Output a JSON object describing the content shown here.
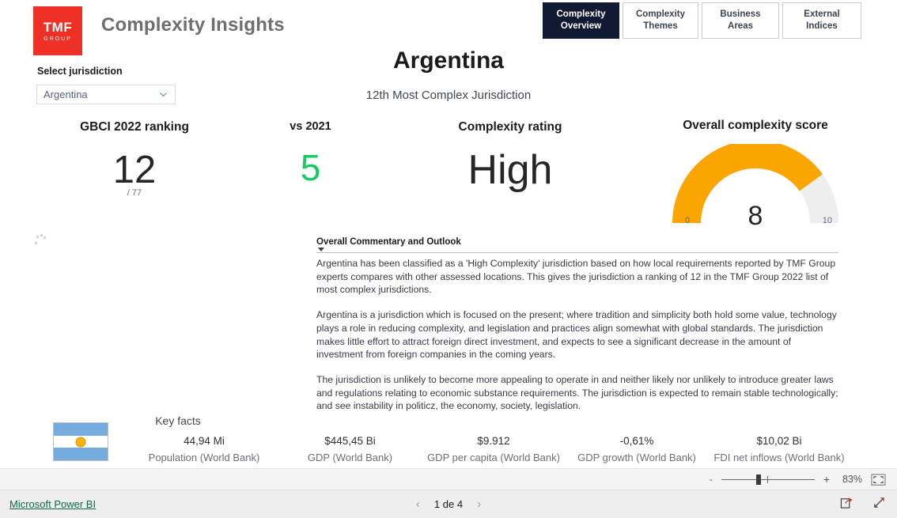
{
  "header": {
    "logo": {
      "primary": "TMF",
      "secondary": "GROUP",
      "color": "#ee3124"
    },
    "title": "Complexity Insights"
  },
  "tabs": [
    {
      "label": "Complexity Overview",
      "active": true
    },
    {
      "label": "Complexity Themes",
      "active": false
    },
    {
      "label": "Business Areas",
      "active": false
    },
    {
      "label": "External Indices",
      "active": false
    }
  ],
  "selector": {
    "label": "Select jurisdiction",
    "value": "Argentina",
    "placeholder": "Select jurisdiction"
  },
  "jurisdiction": {
    "name": "Argentina",
    "subtitle": "12th Most Complex Jurisdiction"
  },
  "kpis": {
    "ranking": {
      "caption": "GBCI 2022 ranking",
      "value": "12",
      "sub": "/ 77"
    },
    "vs_previous": {
      "caption": "vs 2021",
      "value": "5",
      "color": "#18c964"
    },
    "rating": {
      "caption": "Complexity rating",
      "value": "High"
    },
    "score": {
      "caption": "Overall complexity score",
      "value": "8",
      "min": "0",
      "max": "10",
      "fill_color": "#faa500",
      "track_color": "#eeeeee"
    }
  },
  "chart_data": {
    "type": "gauge",
    "title": "Overall complexity score",
    "value": 8,
    "min": 0,
    "max": 10,
    "tick_labels": [
      "0",
      "10"
    ],
    "fill_color": "#faa500",
    "track_color": "#eeeeee"
  },
  "commentary": {
    "title": "Overall Commentary and Outlook",
    "paragraphs": [
      "Argentina has been classified as a 'High Complexity' jurisdiction based on how local requirements reported by TMF Group experts compares with other assessed locations. This gives the jurisdiction a ranking of 12 in the TMF Group 2022 list of most complex jurisdictions.",
      "Argentina is a jurisdiction which is focused on the present; where tradition and simplicity both hold some value, technology plays a role in reducing complexity, and legislation and practices align somewhat with global standards. The jurisdiction makes little effort to attract foreign direct investment, and expects to see a significant decrease in the amount of investment from foreign companies in the coming years.",
      "The jurisdiction is unlikely to become more appealing to operate in and neither likely nor unlikely to introduce greater laws and regulations relating to economic substance requirements. The jurisdiction is expected to remain stable technologically; and see instability in politicz, the economy, society, legislation."
    ]
  },
  "key_facts": {
    "title": "Key facts",
    "items": [
      {
        "value": "44,94 Mi",
        "label": "Population (World Bank)"
      },
      {
        "value": "$445,45 Bi",
        "label": "GDP (World Bank)"
      },
      {
        "value": "$9.912",
        "label": "GDP per capita (World Bank)"
      },
      {
        "value": "-0,61%",
        "label": "GDP growth (World Bank)"
      },
      {
        "value": "$10,02 Bi",
        "label": "FDI net inflows (World Bank)"
      }
    ]
  },
  "zoom_bar": {
    "minus": "-",
    "plus": "+",
    "percent": "83%",
    "fit_icon": "fit-to-page-icon"
  },
  "footer": {
    "brand_link": "Microsoft Power BI",
    "prev_icon": "chevron-left-icon",
    "next_icon": "chevron-right-icon",
    "page_text": "1 de 4",
    "share_icon": "share-icon",
    "fullscreen_icon": "fullscreen-icon"
  }
}
